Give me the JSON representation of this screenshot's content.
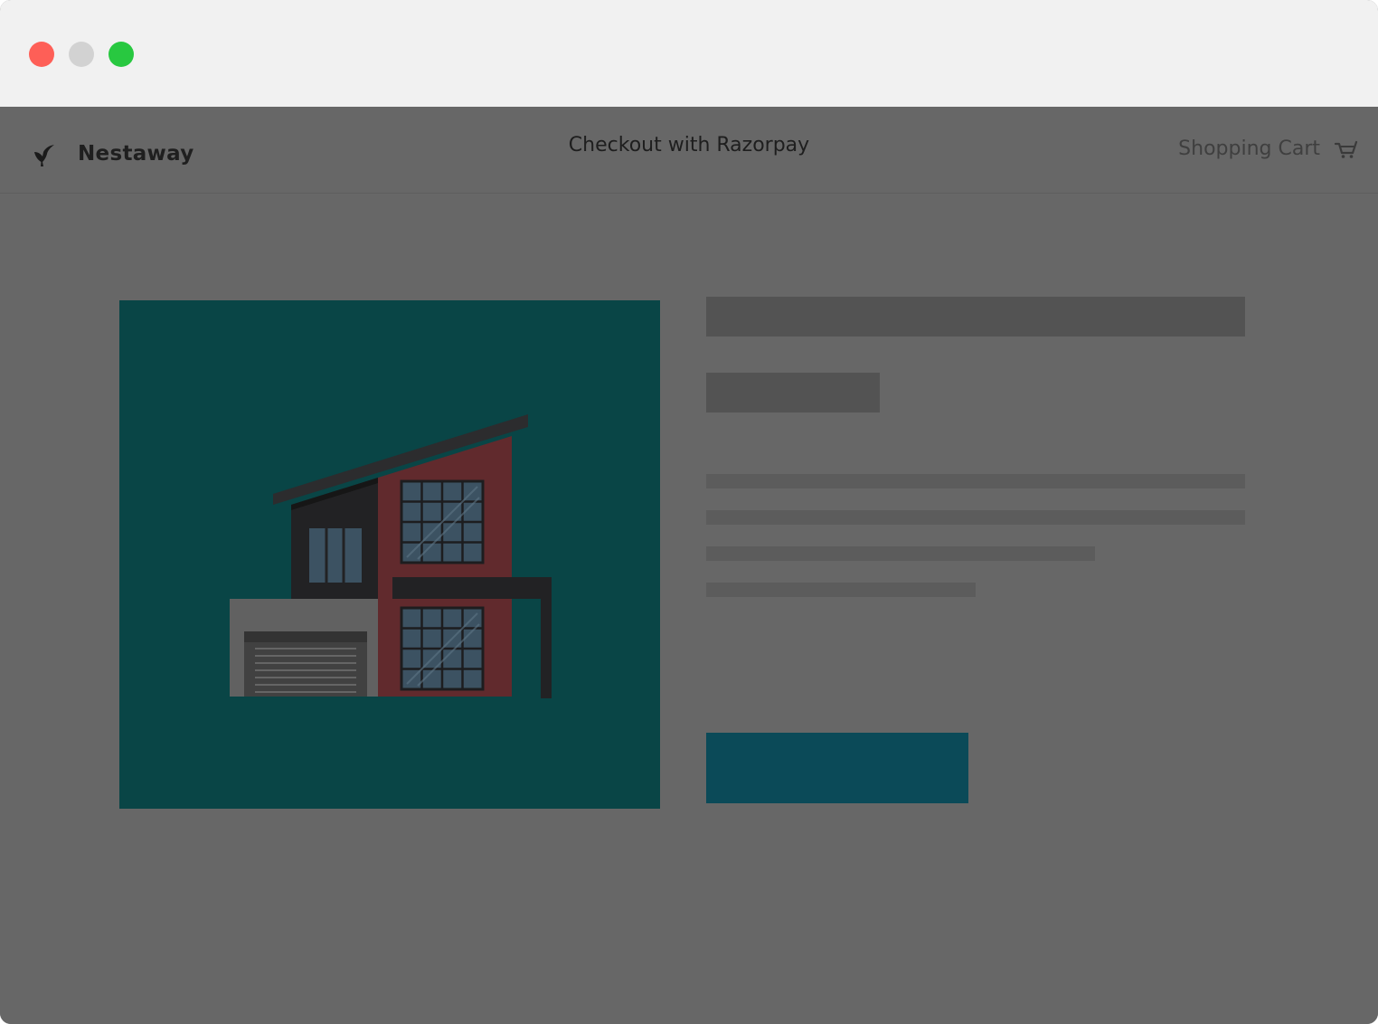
{
  "window": {
    "controls": [
      "close",
      "minimize",
      "maximize"
    ],
    "colors": {
      "close": "#fe5f57",
      "minimize": "#d2d2d2",
      "maximize": "#28c840",
      "titlebar": "#f1f1f1"
    }
  },
  "header": {
    "brand_name": "Nestaway",
    "brand_icon": "bird-logo-icon",
    "title": "Checkout with Razorpay",
    "cart_label": "Shopping Cart",
    "cart_icon": "shopping-cart-icon"
  },
  "product": {
    "image_icon": "house-illustration",
    "image_bg_color": "#094546",
    "details_loading": true
  },
  "checkout": {
    "pay_button_label": "",
    "pay_button_color": "#0b4a58"
  },
  "overlay_color": "#676767"
}
